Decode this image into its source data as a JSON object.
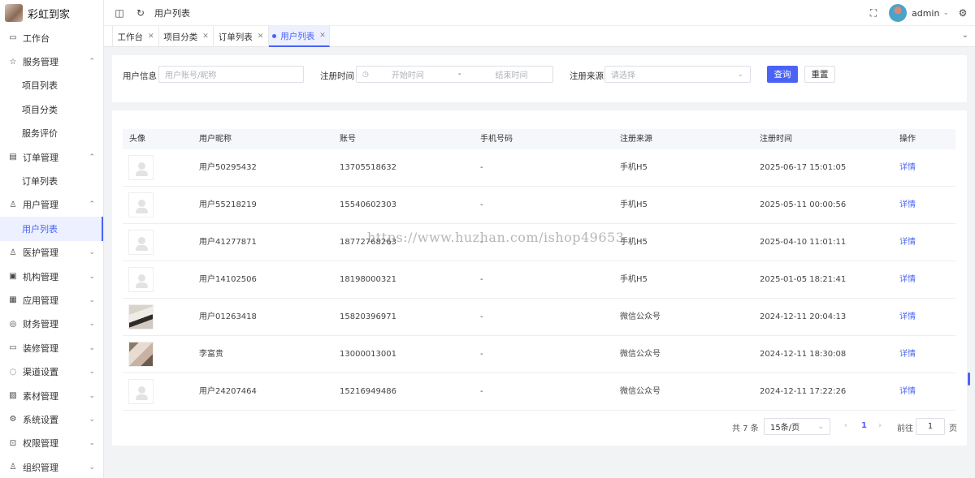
{
  "brand": {
    "name": "彩虹到家"
  },
  "sidebar": {
    "items": [
      {
        "label": "工作台",
        "icon": "monitor-icon",
        "glyph": "▭",
        "chevron": "",
        "level": 0
      },
      {
        "label": "服务管理",
        "icon": "star-icon",
        "glyph": "☆",
        "chevron": "⌃",
        "level": 0
      },
      {
        "label": "项目列表",
        "icon": "",
        "glyph": "",
        "chevron": "",
        "level": 1
      },
      {
        "label": "项目分类",
        "icon": "",
        "glyph": "",
        "chevron": "",
        "level": 1
      },
      {
        "label": "服务评价",
        "icon": "",
        "glyph": "",
        "chevron": "",
        "level": 1
      },
      {
        "label": "订单管理",
        "icon": "document-icon",
        "glyph": "▤",
        "chevron": "⌃",
        "level": 0
      },
      {
        "label": "订单列表",
        "icon": "",
        "glyph": "",
        "chevron": "",
        "level": 1
      },
      {
        "label": "用户管理",
        "icon": "user-icon",
        "glyph": "♙",
        "chevron": "⌃",
        "level": 0
      },
      {
        "label": "用户列表",
        "icon": "",
        "glyph": "",
        "chevron": "",
        "level": 1,
        "active": true
      },
      {
        "label": "医护管理",
        "icon": "nurse-icon",
        "glyph": "♙",
        "chevron": "⌄",
        "level": 0
      },
      {
        "label": "机构管理",
        "icon": "briefcase-icon",
        "glyph": "▣",
        "chevron": "⌄",
        "level": 0
      },
      {
        "label": "应用管理",
        "icon": "apps-icon",
        "glyph": "▦",
        "chevron": "⌄",
        "level": 0
      },
      {
        "label": "财务管理",
        "icon": "yuan-icon",
        "glyph": "◎",
        "chevron": "⌄",
        "level": 0
      },
      {
        "label": "装修管理",
        "icon": "decorate-icon",
        "glyph": "▭",
        "chevron": "⌄",
        "level": 0
      },
      {
        "label": "渠道设置",
        "icon": "chat-icon",
        "glyph": "◌",
        "chevron": "⌄",
        "level": 0
      },
      {
        "label": "素材管理",
        "icon": "image-icon",
        "glyph": "▨",
        "chevron": "⌄",
        "level": 0
      },
      {
        "label": "系统设置",
        "icon": "gear-icon",
        "glyph": "⚙",
        "chevron": "⌄",
        "level": 0
      },
      {
        "label": "权限管理",
        "icon": "lock-icon",
        "glyph": "⊡",
        "chevron": "⌄",
        "level": 0
      },
      {
        "label": "组织管理",
        "icon": "org-icon",
        "glyph": "♙",
        "chevron": "⌄",
        "level": 0
      }
    ]
  },
  "header": {
    "breadcrumb": "用户列表",
    "username": "admin"
  },
  "tabs": [
    {
      "label": "工作台"
    },
    {
      "label": "项目分类"
    },
    {
      "label": "订单列表"
    },
    {
      "label": "用户列表",
      "active": true
    }
  ],
  "filter": {
    "user_info_label": "用户信息",
    "user_info_placeholder": "用户账号/昵称",
    "reg_time_label": "注册时间",
    "start_placeholder": "开始时间",
    "range_sep": "-",
    "end_placeholder": "结束时间",
    "source_label": "注册来源",
    "source_placeholder": "请选择",
    "search_button": "查询",
    "reset_button": "重置"
  },
  "table": {
    "columns": [
      "头像",
      "用户昵称",
      "账号",
      "手机号码",
      "注册来源",
      "注册时间",
      "操作"
    ],
    "rows": [
      {
        "avatar": "placeholder",
        "nickname": "用户50295432",
        "account": "13705518632",
        "phone": "-",
        "source": "手机H5",
        "time": "2025-06-17 15:01:05",
        "action": "详情"
      },
      {
        "avatar": "placeholder",
        "nickname": "用户55218219",
        "account": "15540602303",
        "phone": "-",
        "source": "手机H5",
        "time": "2025-05-11 00:00:56",
        "action": "详情"
      },
      {
        "avatar": "placeholder",
        "nickname": "用户41277871",
        "account": "18772768263",
        "phone": "-",
        "source": "手机H5",
        "time": "2025-04-10 11:01:11",
        "action": "详情"
      },
      {
        "avatar": "placeholder",
        "nickname": "用户14102506",
        "account": "18198000321",
        "phone": "-",
        "source": "手机H5",
        "time": "2025-01-05 18:21:41",
        "action": "详情"
      },
      {
        "avatar": "photo1",
        "nickname": "用户01263418",
        "account": "15820396971",
        "phone": "-",
        "source": "微信公众号",
        "time": "2024-12-11 20:04:13",
        "action": "详情"
      },
      {
        "avatar": "photo2",
        "nickname": "李富贵",
        "account": "13000013001",
        "phone": "-",
        "source": "微信公众号",
        "time": "2024-12-11 18:30:08",
        "action": "详情"
      },
      {
        "avatar": "placeholder",
        "nickname": "用户24207464",
        "account": "15216949486",
        "phone": "-",
        "source": "微信公众号",
        "time": "2024-12-11 17:22:26",
        "action": "详情"
      }
    ]
  },
  "pagination": {
    "total_text": "共 7 条",
    "page_size": "15条/页",
    "current_page": "1",
    "goto_label": "前往",
    "goto_value": "1",
    "page_unit": "页"
  },
  "watermark": "https://www.huzhan.com/ishop49653",
  "colors": {
    "accent": "#4a63f5"
  }
}
